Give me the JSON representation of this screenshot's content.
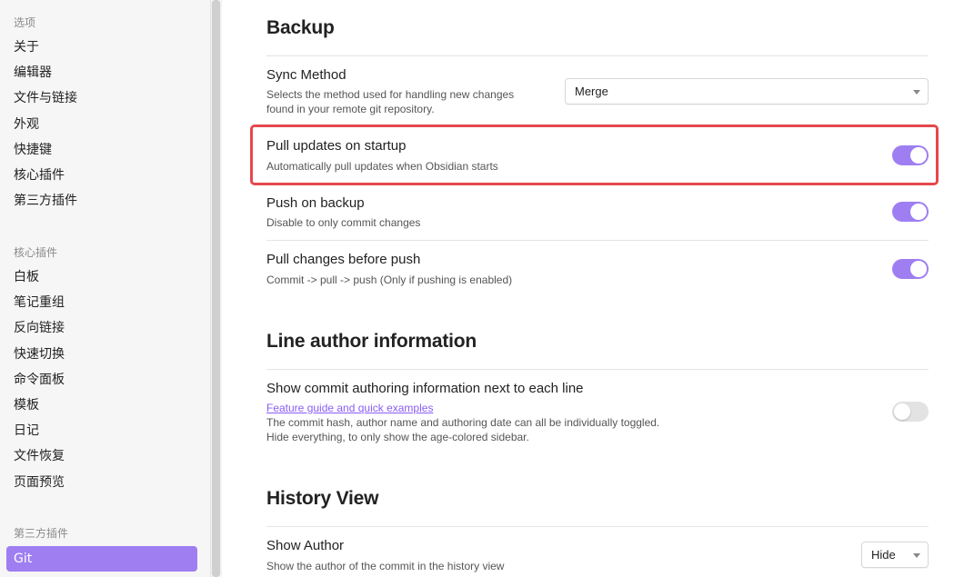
{
  "sidebar": {
    "sections": [
      {
        "label": "选项",
        "items": [
          "关于",
          "编辑器",
          "文件与链接",
          "外观",
          "快捷键",
          "核心插件",
          "第三方插件"
        ]
      },
      {
        "label": "核心插件",
        "items": [
          "白板",
          "笔记重组",
          "反向链接",
          "快速切换",
          "命令面板",
          "模板",
          "日记",
          "文件恢复",
          "页面预览"
        ]
      },
      {
        "label": "第三方插件",
        "items": [
          "Git"
        ]
      }
    ],
    "active_item": "Git"
  },
  "backup": {
    "title": "Backup",
    "sync_method": {
      "name": "Sync Method",
      "desc_line1": "Selects the method used for handling new changes",
      "desc_line2": "found in your remote git repository.",
      "value": "Merge"
    },
    "pull_on_startup": {
      "name": "Pull updates on startup",
      "desc": "Automatically pull updates when Obsidian starts",
      "enabled": true
    },
    "push_on_backup": {
      "name": "Push on backup",
      "desc": "Disable to only commit changes",
      "enabled": true
    },
    "pull_before_push": {
      "name": "Pull changes before push",
      "desc": "Commit -> pull -> push (Only if pushing is enabled)",
      "enabled": true
    }
  },
  "line_author": {
    "title": "Line author information",
    "show_commit_info": {
      "name": "Show commit authoring information next to each line",
      "link": "Feature guide and quick examples",
      "desc_line1": "The commit hash, author name and authoring date can all be individually toggled.",
      "desc_line2": "Hide everything, to only show the age-colored sidebar.",
      "enabled": false
    }
  },
  "history_view": {
    "title": "History View",
    "show_author": {
      "name": "Show Author",
      "desc": "Show the author of the commit in the history view",
      "value": "Hide"
    }
  },
  "colors": {
    "accent": "#9f7ef2",
    "highlight": "#e5484d",
    "link": "#8a5cf5"
  }
}
